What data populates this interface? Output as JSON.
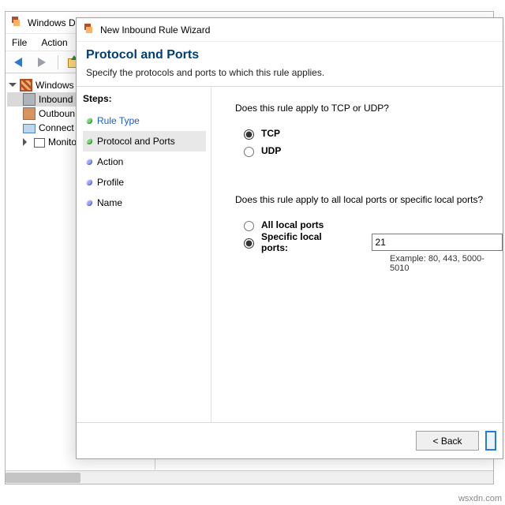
{
  "parent_window": {
    "title": "Windows Defender Firewall with Advanced Security",
    "menu": {
      "file": "File",
      "action": "Action"
    },
    "tree": {
      "root": "Windows De",
      "inbound": "Inbound",
      "outbound": "Outboun",
      "connection": "Connect",
      "monitoring": "Monitori"
    }
  },
  "wizard": {
    "window_title": "New Inbound Rule Wizard",
    "heading": "Protocol and Ports",
    "description": "Specify the protocols and ports to which this rule applies.",
    "steps_label": "Steps:",
    "steps": {
      "rule_type": "Rule Type",
      "protocol_ports": "Protocol and Ports",
      "action": "Action",
      "profile": "Profile",
      "name": "Name"
    },
    "q_protocol": "Does this rule apply to TCP or UDP?",
    "opt_tcp": "TCP",
    "opt_udp": "UDP",
    "q_ports": "Does this rule apply to all local ports or specific local ports?",
    "opt_all_ports": "All local ports",
    "opt_specific_ports": "Specific local ports:",
    "port_value": "21",
    "port_example": "Example: 80, 443, 5000-5010",
    "buttons": {
      "back": "< Back"
    }
  },
  "watermark": "wsxdn.com"
}
